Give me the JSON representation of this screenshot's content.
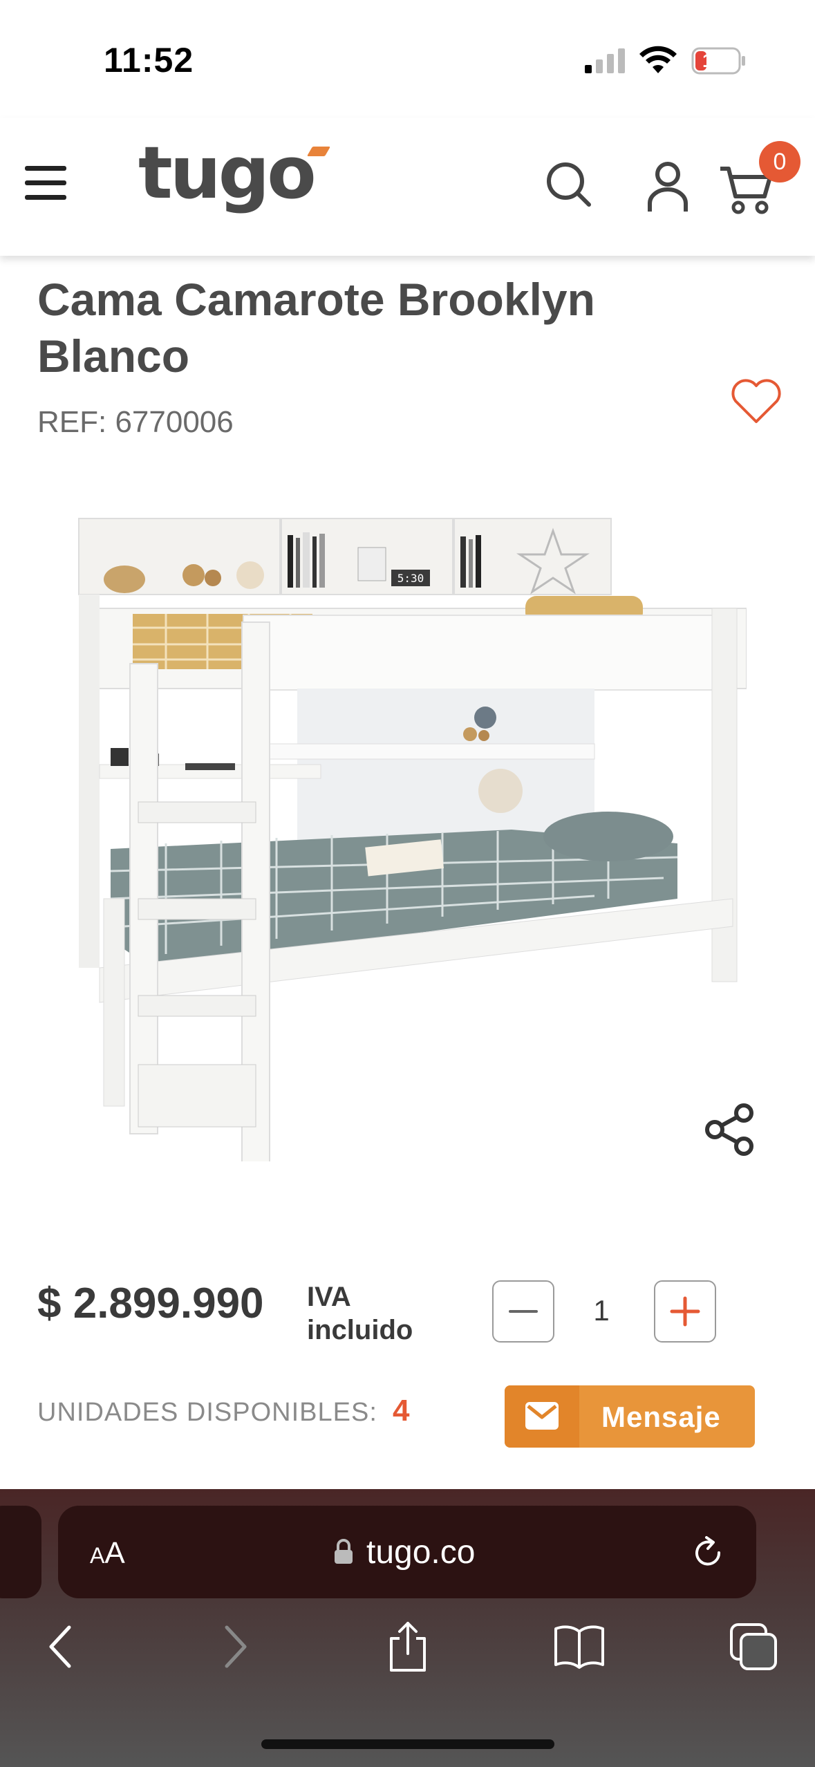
{
  "status_bar": {
    "time": "11:52",
    "battery_level": "12"
  },
  "header": {
    "logo": "tugo",
    "cart_count": "0",
    "accent_color": "#e8833a"
  },
  "product": {
    "title": "Cama Camarote Brooklyn Blanco",
    "ref": "REF: 6770006",
    "price": "$ 2.899.990",
    "iva_note": "IVA incluido",
    "quantity": "1",
    "units_label": "UNIDADES DISPONIBLES:",
    "units_value": "4",
    "message_button": "Mensaje",
    "image_clock": "5:30"
  },
  "browser": {
    "aa_label_small": "A",
    "aa_label_large": "A",
    "url": "tugo.co"
  },
  "icons": {
    "menu": "hamburger-icon",
    "search": "search-icon",
    "account": "user-icon",
    "cart": "cart-icon",
    "wishlist": "heart-icon",
    "share": "share-icon",
    "message": "envelope-icon"
  }
}
